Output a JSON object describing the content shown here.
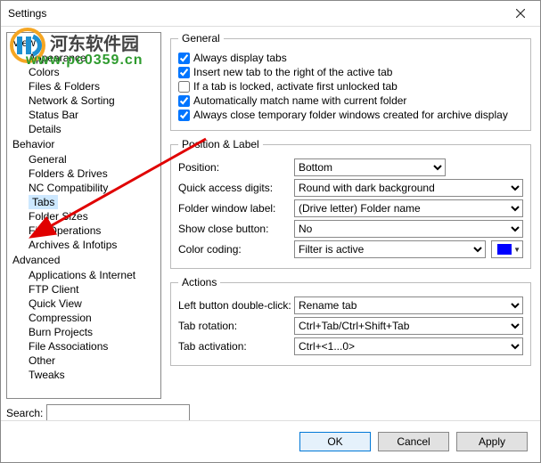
{
  "window": {
    "title": "Settings"
  },
  "tree": {
    "categories": [
      {
        "label": "View",
        "items": [
          "Appearance",
          "Colors",
          "Files & Folders",
          "Network & Sorting",
          "Status Bar",
          "Details"
        ]
      },
      {
        "label": "Behavior",
        "items": [
          "General",
          "Folders & Drives",
          "NC Compatibility",
          "Tabs",
          "Folder Sizes",
          "File Operations",
          "Archives & Infotips"
        ]
      },
      {
        "label": "Advanced",
        "items": [
          "Applications & Internet",
          "FTP Client",
          "Quick View",
          "Compression",
          "Burn Projects",
          "File Associations",
          "Other",
          "Tweaks"
        ]
      }
    ],
    "selected": "Tabs"
  },
  "search": {
    "label": "Search:",
    "value": ""
  },
  "general": {
    "legend": "General",
    "items": [
      {
        "label": "Always display tabs",
        "checked": true
      },
      {
        "label": "Insert new tab to the right of the active tab",
        "checked": true
      },
      {
        "label": "If a tab is locked, activate first unlocked tab",
        "checked": false
      },
      {
        "label": "Automatically match name with current folder",
        "checked": true
      },
      {
        "label": "Always close temporary folder windows created for archive display",
        "checked": true
      }
    ]
  },
  "position_label": {
    "legend": "Position & Label",
    "rows": {
      "position": {
        "label": "Position:",
        "value": "Bottom"
      },
      "quick_access": {
        "label": "Quick access digits:",
        "value": "Round with dark background"
      },
      "folder_window": {
        "label": "Folder window label:",
        "value": "(Drive letter) Folder name"
      },
      "show_close": {
        "label": "Show close button:",
        "value": "No"
      },
      "color_coding": {
        "label": "Color coding:",
        "value": "Filter is active",
        "swatch": "#0000ff"
      }
    }
  },
  "actions": {
    "legend": "Actions",
    "rows": {
      "double_click": {
        "label": "Left button double-click:",
        "value": "Rename tab"
      },
      "tab_rotation": {
        "label": "Tab rotation:",
        "value": "Ctrl+Tab/Ctrl+Shift+Tab"
      },
      "tab_activation": {
        "label": "Tab activation:",
        "value": "Ctrl+<1...0>"
      }
    }
  },
  "buttons": {
    "ok": "OK",
    "cancel": "Cancel",
    "apply": "Apply"
  },
  "watermark": {
    "site_name": "河东软件园",
    "url": "www.pc0359.cn"
  }
}
